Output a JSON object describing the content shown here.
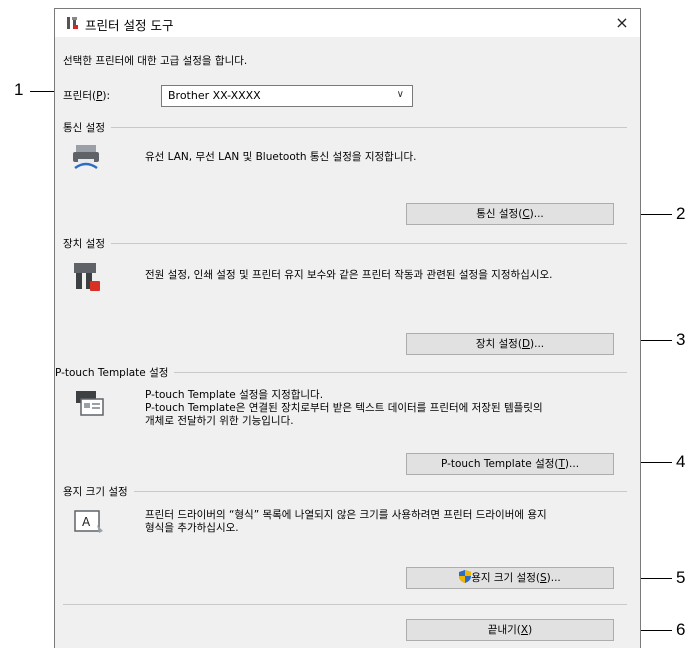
{
  "window": {
    "title": "프린터 설정 도구",
    "close_label": "×"
  },
  "intro": "선택한 프린터에 대한 고급 설정을 합니다.",
  "printer": {
    "label": "프린터(",
    "accel": "P",
    "label_end": "):",
    "selected": "Brother XX-XXXX",
    "chevron": "∨"
  },
  "comm": {
    "heading": "통신 설정",
    "desc": "유선 LAN, 무선 LAN 및 Bluetooth 통신 설정을 지정합니다.",
    "button_pre": "통신 설정(",
    "button_accel": "C",
    "button_post": ")..."
  },
  "device": {
    "heading": "장치 설정",
    "desc": "전원 설정, 인쇄 설정 및 프린터 유지 보수와 같은 프린터 작동과 관련된 설정을 지정하십시오.",
    "button_pre": "장치 설정(",
    "button_accel": "D",
    "button_post": ")..."
  },
  "template": {
    "heading": "P-touch Template 설정",
    "desc1": "P-touch Template 설정을 지정합니다.",
    "desc2": "P-touch Template은 연결된 장치로부터 받은 텍스트 데이터를 프린터에 저장된 템플릿의",
    "desc3": "개체로 전달하기 위한 기능입니다.",
    "button_pre": "P-touch Template 설정(",
    "button_accel": "T",
    "button_post": ")..."
  },
  "paper": {
    "heading": "용지 크기 설정",
    "desc1": "프린터 드라이버의 “형식” 목록에 나열되지 않은 크기를 사용하려면 프린터 드라이버에 용지",
    "desc2": "형식을 추가하십시오.",
    "button_pre": "용지 크기 설정(",
    "button_accel": "S",
    "button_post": ")..."
  },
  "exit": {
    "button_pre": "끝내기(",
    "button_accel": "X",
    "button_post": ")"
  },
  "callouts": [
    "1",
    "2",
    "3",
    "4",
    "5",
    "6"
  ],
  "colors": {
    "window_bg": "#f0f0f0",
    "button_bg": "#e1e1e1",
    "shield_blue": "#2b6cc4",
    "shield_yellow": "#f2b600"
  }
}
